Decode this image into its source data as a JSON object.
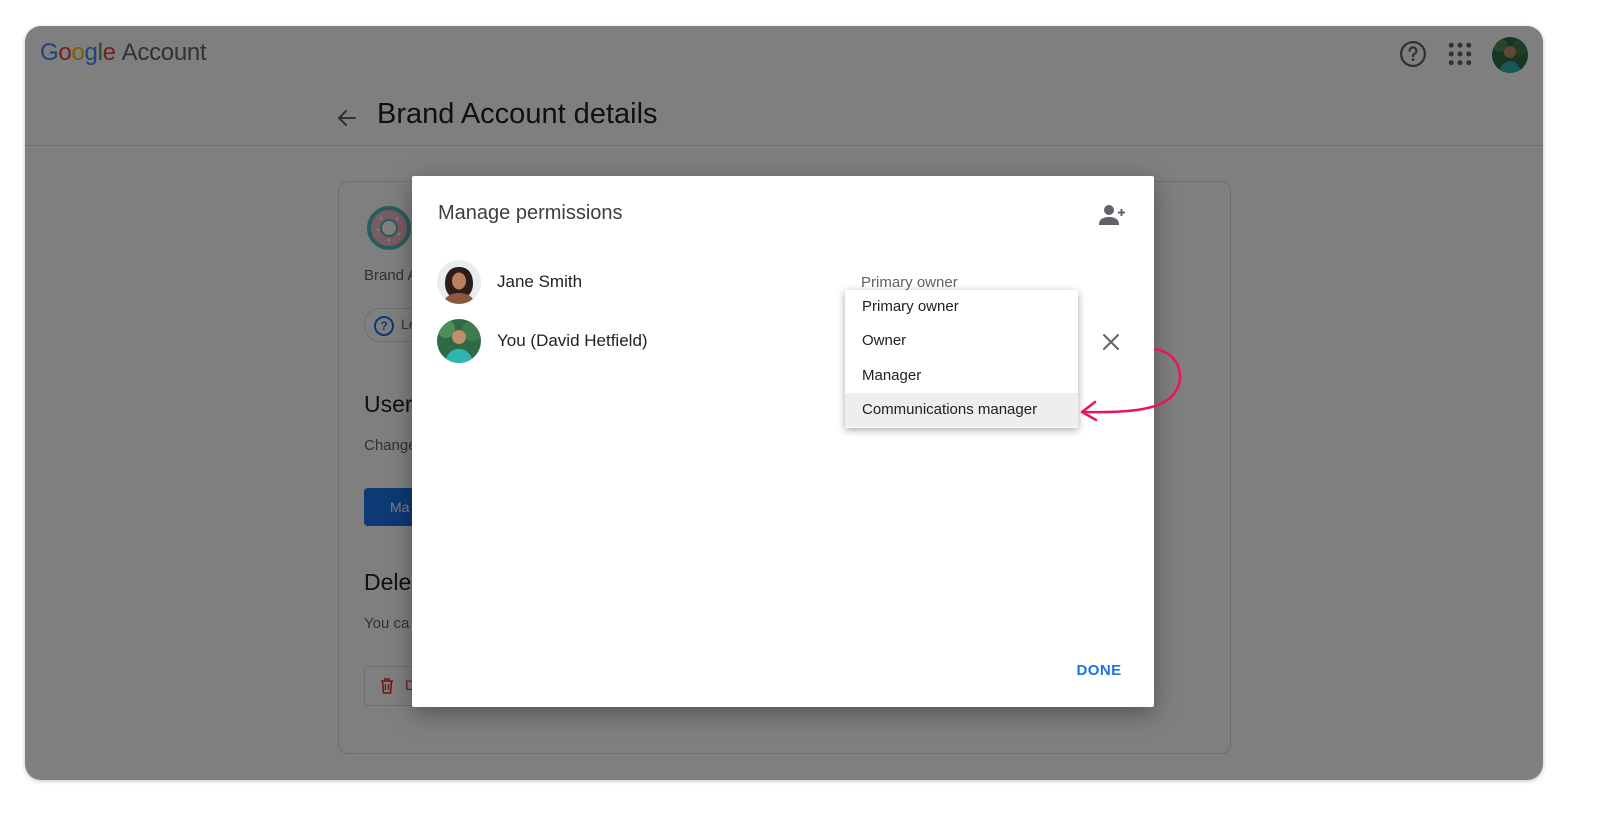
{
  "header": {
    "logo": {
      "letters": [
        "G",
        "o",
        "o",
        "g",
        "l",
        "e"
      ],
      "suffix": "Account"
    },
    "help_icon": "help-circle-icon",
    "apps_icon": "apps-grid-icon",
    "avatar_icon": "user-avatar"
  },
  "page": {
    "title": "Brand Account details",
    "back_icon": "arrow-left-icon"
  },
  "background_card": {
    "brand_label": "Brand A",
    "learn_chip": "Le",
    "users_heading": "User",
    "users_desc": "Change",
    "manage_button": "Ma",
    "delete_heading": "Dele",
    "delete_desc": "You ca",
    "delete_button": "D"
  },
  "dialog": {
    "title": "Manage permissions",
    "add_person_icon": "person-add-icon",
    "people": [
      {
        "name": "Jane Smith",
        "role": "Primary owner"
      },
      {
        "name": "You (David Hetfield)",
        "role": ""
      }
    ],
    "remove_icon": "close-icon",
    "done_label": "DONE"
  },
  "role_menu": {
    "items": [
      {
        "label": "Primary owner"
      },
      {
        "label": "Owner"
      },
      {
        "label": "Manager"
      },
      {
        "label": "Communications manager"
      }
    ],
    "highlighted": "Communications manager"
  },
  "colors": {
    "accent": "#1a73e8",
    "annotation": "#e8175d",
    "scrim": "#808080"
  }
}
